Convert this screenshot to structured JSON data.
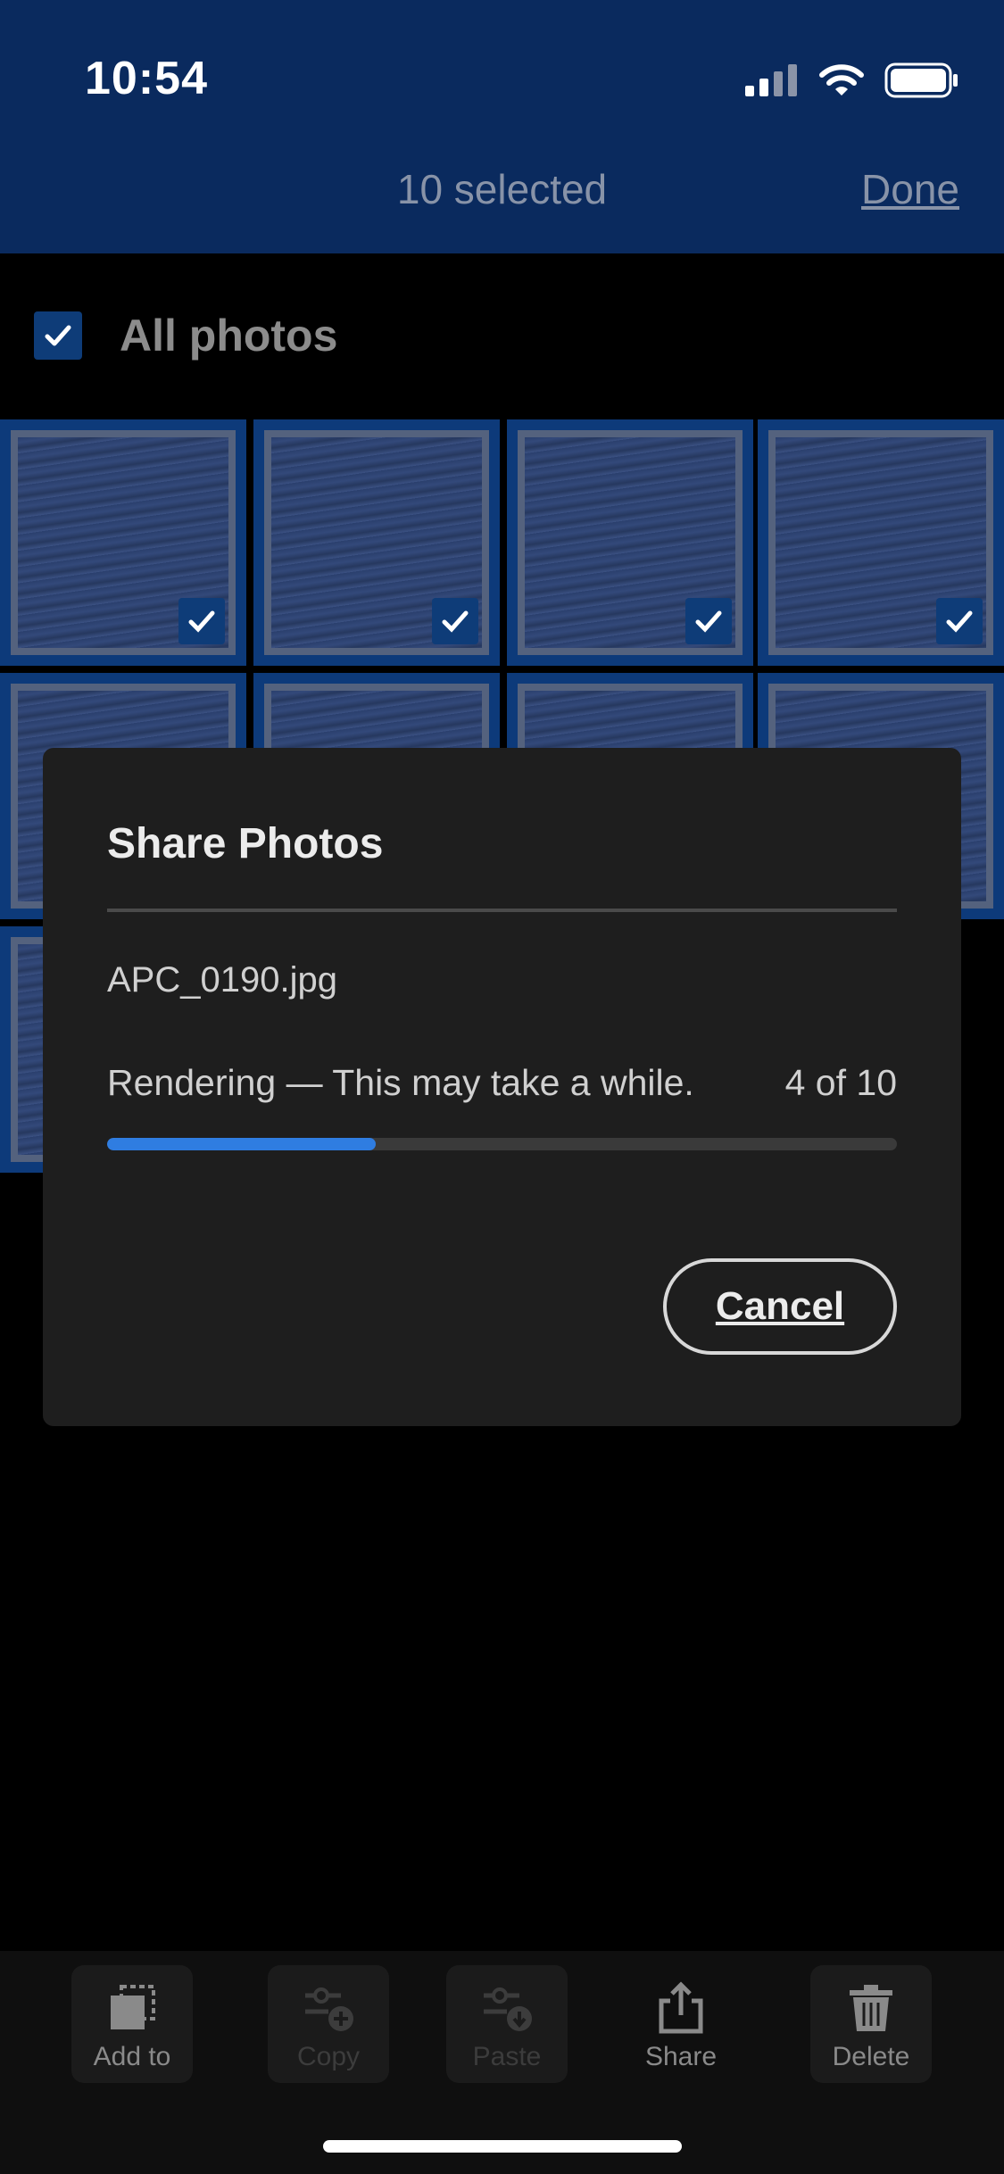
{
  "status_bar": {
    "time": "10:54"
  },
  "header": {
    "title": "10 selected",
    "done_label": "Done"
  },
  "filter": {
    "label": "All photos",
    "checked": true
  },
  "grid": {
    "visible_rows": 4,
    "columns": 4
  },
  "dialog": {
    "title": "Share Photos",
    "file_name": "APC_0190.jpg",
    "status": "Rendering — This may take a while.",
    "count": "4 of 10",
    "progress": 0.34,
    "cancel_label": "Cancel"
  },
  "toolbar": {
    "items": [
      {
        "label": "Add to",
        "icon": "add-to-icon",
        "enabled": true
      },
      {
        "label": "Copy",
        "icon": "copy-settings-icon",
        "enabled": false
      },
      {
        "label": "Paste",
        "icon": "paste-settings-icon",
        "enabled": false
      },
      {
        "label": "Share",
        "icon": "share-icon",
        "enabled": true
      },
      {
        "label": "Delete",
        "icon": "trash-icon",
        "enabled": true
      }
    ]
  },
  "colors": {
    "header_bg": "#0a2a5e",
    "accent": "#2f7de1",
    "dialog_bg": "#1e1e1e"
  }
}
